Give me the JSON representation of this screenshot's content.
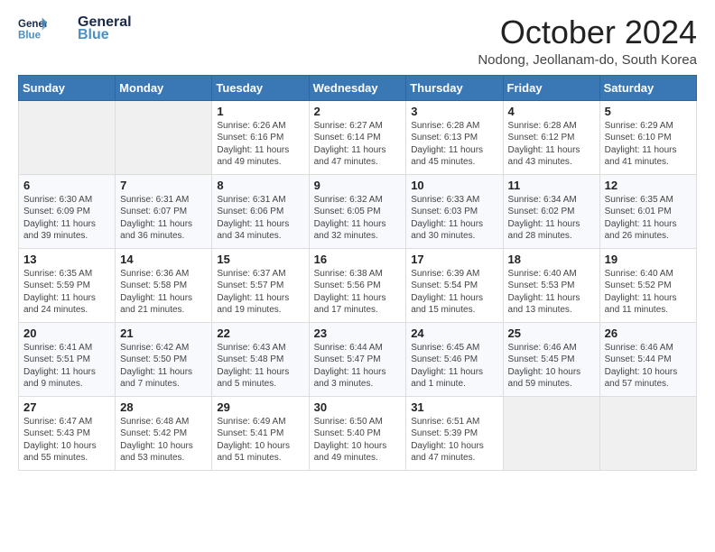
{
  "header": {
    "logo_line1": "General",
    "logo_line2": "Blue",
    "month_title": "October 2024",
    "location": "Nodong, Jeollanam-do, South Korea"
  },
  "weekdays": [
    "Sunday",
    "Monday",
    "Tuesday",
    "Wednesday",
    "Thursday",
    "Friday",
    "Saturday"
  ],
  "weeks": [
    [
      {
        "day": "",
        "info": ""
      },
      {
        "day": "",
        "info": ""
      },
      {
        "day": "1",
        "info": "Sunrise: 6:26 AM\nSunset: 6:16 PM\nDaylight: 11 hours and 49 minutes."
      },
      {
        "day": "2",
        "info": "Sunrise: 6:27 AM\nSunset: 6:14 PM\nDaylight: 11 hours and 47 minutes."
      },
      {
        "day": "3",
        "info": "Sunrise: 6:28 AM\nSunset: 6:13 PM\nDaylight: 11 hours and 45 minutes."
      },
      {
        "day": "4",
        "info": "Sunrise: 6:28 AM\nSunset: 6:12 PM\nDaylight: 11 hours and 43 minutes."
      },
      {
        "day": "5",
        "info": "Sunrise: 6:29 AM\nSunset: 6:10 PM\nDaylight: 11 hours and 41 minutes."
      }
    ],
    [
      {
        "day": "6",
        "info": "Sunrise: 6:30 AM\nSunset: 6:09 PM\nDaylight: 11 hours and 39 minutes."
      },
      {
        "day": "7",
        "info": "Sunrise: 6:31 AM\nSunset: 6:07 PM\nDaylight: 11 hours and 36 minutes."
      },
      {
        "day": "8",
        "info": "Sunrise: 6:31 AM\nSunset: 6:06 PM\nDaylight: 11 hours and 34 minutes."
      },
      {
        "day": "9",
        "info": "Sunrise: 6:32 AM\nSunset: 6:05 PM\nDaylight: 11 hours and 32 minutes."
      },
      {
        "day": "10",
        "info": "Sunrise: 6:33 AM\nSunset: 6:03 PM\nDaylight: 11 hours and 30 minutes."
      },
      {
        "day": "11",
        "info": "Sunrise: 6:34 AM\nSunset: 6:02 PM\nDaylight: 11 hours and 28 minutes."
      },
      {
        "day": "12",
        "info": "Sunrise: 6:35 AM\nSunset: 6:01 PM\nDaylight: 11 hours and 26 minutes."
      }
    ],
    [
      {
        "day": "13",
        "info": "Sunrise: 6:35 AM\nSunset: 5:59 PM\nDaylight: 11 hours and 24 minutes."
      },
      {
        "day": "14",
        "info": "Sunrise: 6:36 AM\nSunset: 5:58 PM\nDaylight: 11 hours and 21 minutes."
      },
      {
        "day": "15",
        "info": "Sunrise: 6:37 AM\nSunset: 5:57 PM\nDaylight: 11 hours and 19 minutes."
      },
      {
        "day": "16",
        "info": "Sunrise: 6:38 AM\nSunset: 5:56 PM\nDaylight: 11 hours and 17 minutes."
      },
      {
        "day": "17",
        "info": "Sunrise: 6:39 AM\nSunset: 5:54 PM\nDaylight: 11 hours and 15 minutes."
      },
      {
        "day": "18",
        "info": "Sunrise: 6:40 AM\nSunset: 5:53 PM\nDaylight: 11 hours and 13 minutes."
      },
      {
        "day": "19",
        "info": "Sunrise: 6:40 AM\nSunset: 5:52 PM\nDaylight: 11 hours and 11 minutes."
      }
    ],
    [
      {
        "day": "20",
        "info": "Sunrise: 6:41 AM\nSunset: 5:51 PM\nDaylight: 11 hours and 9 minutes."
      },
      {
        "day": "21",
        "info": "Sunrise: 6:42 AM\nSunset: 5:50 PM\nDaylight: 11 hours and 7 minutes."
      },
      {
        "day": "22",
        "info": "Sunrise: 6:43 AM\nSunset: 5:48 PM\nDaylight: 11 hours and 5 minutes."
      },
      {
        "day": "23",
        "info": "Sunrise: 6:44 AM\nSunset: 5:47 PM\nDaylight: 11 hours and 3 minutes."
      },
      {
        "day": "24",
        "info": "Sunrise: 6:45 AM\nSunset: 5:46 PM\nDaylight: 11 hours and 1 minute."
      },
      {
        "day": "25",
        "info": "Sunrise: 6:46 AM\nSunset: 5:45 PM\nDaylight: 10 hours and 59 minutes."
      },
      {
        "day": "26",
        "info": "Sunrise: 6:46 AM\nSunset: 5:44 PM\nDaylight: 10 hours and 57 minutes."
      }
    ],
    [
      {
        "day": "27",
        "info": "Sunrise: 6:47 AM\nSunset: 5:43 PM\nDaylight: 10 hours and 55 minutes."
      },
      {
        "day": "28",
        "info": "Sunrise: 6:48 AM\nSunset: 5:42 PM\nDaylight: 10 hours and 53 minutes."
      },
      {
        "day": "29",
        "info": "Sunrise: 6:49 AM\nSunset: 5:41 PM\nDaylight: 10 hours and 51 minutes."
      },
      {
        "day": "30",
        "info": "Sunrise: 6:50 AM\nSunset: 5:40 PM\nDaylight: 10 hours and 49 minutes."
      },
      {
        "day": "31",
        "info": "Sunrise: 6:51 AM\nSunset: 5:39 PM\nDaylight: 10 hours and 47 minutes."
      },
      {
        "day": "",
        "info": ""
      },
      {
        "day": "",
        "info": ""
      }
    ]
  ]
}
